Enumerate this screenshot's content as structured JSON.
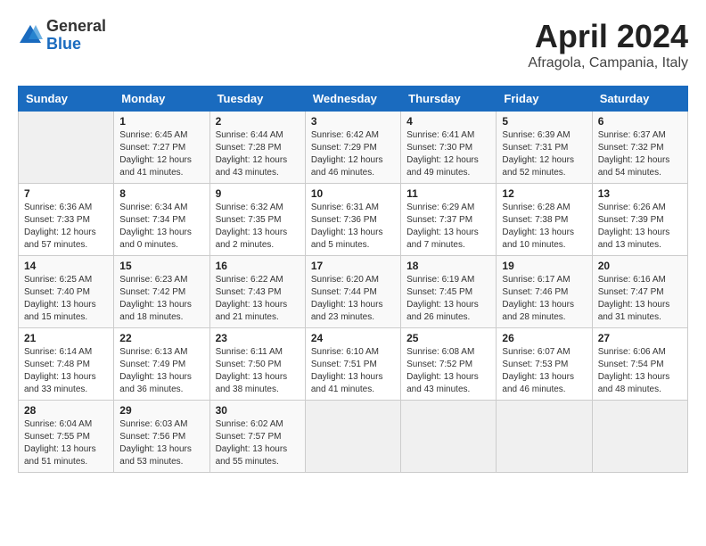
{
  "header": {
    "logo_general": "General",
    "logo_blue": "Blue",
    "month_title": "April 2024",
    "location": "Afragola, Campania, Italy"
  },
  "calendar": {
    "days_of_week": [
      "Sunday",
      "Monday",
      "Tuesday",
      "Wednesday",
      "Thursday",
      "Friday",
      "Saturday"
    ],
    "weeks": [
      [
        {
          "day": "",
          "empty": true
        },
        {
          "day": "1",
          "sunrise": "Sunrise: 6:45 AM",
          "sunset": "Sunset: 7:27 PM",
          "daylight": "Daylight: 12 hours and 41 minutes."
        },
        {
          "day": "2",
          "sunrise": "Sunrise: 6:44 AM",
          "sunset": "Sunset: 7:28 PM",
          "daylight": "Daylight: 12 hours and 43 minutes."
        },
        {
          "day": "3",
          "sunrise": "Sunrise: 6:42 AM",
          "sunset": "Sunset: 7:29 PM",
          "daylight": "Daylight: 12 hours and 46 minutes."
        },
        {
          "day": "4",
          "sunrise": "Sunrise: 6:41 AM",
          "sunset": "Sunset: 7:30 PM",
          "daylight": "Daylight: 12 hours and 49 minutes."
        },
        {
          "day": "5",
          "sunrise": "Sunrise: 6:39 AM",
          "sunset": "Sunset: 7:31 PM",
          "daylight": "Daylight: 12 hours and 52 minutes."
        },
        {
          "day": "6",
          "sunrise": "Sunrise: 6:37 AM",
          "sunset": "Sunset: 7:32 PM",
          "daylight": "Daylight: 12 hours and 54 minutes."
        }
      ],
      [
        {
          "day": "7",
          "sunrise": "Sunrise: 6:36 AM",
          "sunset": "Sunset: 7:33 PM",
          "daylight": "Daylight: 12 hours and 57 minutes."
        },
        {
          "day": "8",
          "sunrise": "Sunrise: 6:34 AM",
          "sunset": "Sunset: 7:34 PM",
          "daylight": "Daylight: 13 hours and 0 minutes."
        },
        {
          "day": "9",
          "sunrise": "Sunrise: 6:32 AM",
          "sunset": "Sunset: 7:35 PM",
          "daylight": "Daylight: 13 hours and 2 minutes."
        },
        {
          "day": "10",
          "sunrise": "Sunrise: 6:31 AM",
          "sunset": "Sunset: 7:36 PM",
          "daylight": "Daylight: 13 hours and 5 minutes."
        },
        {
          "day": "11",
          "sunrise": "Sunrise: 6:29 AM",
          "sunset": "Sunset: 7:37 PM",
          "daylight": "Daylight: 13 hours and 7 minutes."
        },
        {
          "day": "12",
          "sunrise": "Sunrise: 6:28 AM",
          "sunset": "Sunset: 7:38 PM",
          "daylight": "Daylight: 13 hours and 10 minutes."
        },
        {
          "day": "13",
          "sunrise": "Sunrise: 6:26 AM",
          "sunset": "Sunset: 7:39 PM",
          "daylight": "Daylight: 13 hours and 13 minutes."
        }
      ],
      [
        {
          "day": "14",
          "sunrise": "Sunrise: 6:25 AM",
          "sunset": "Sunset: 7:40 PM",
          "daylight": "Daylight: 13 hours and 15 minutes."
        },
        {
          "day": "15",
          "sunrise": "Sunrise: 6:23 AM",
          "sunset": "Sunset: 7:42 PM",
          "daylight": "Daylight: 13 hours and 18 minutes."
        },
        {
          "day": "16",
          "sunrise": "Sunrise: 6:22 AM",
          "sunset": "Sunset: 7:43 PM",
          "daylight": "Daylight: 13 hours and 21 minutes."
        },
        {
          "day": "17",
          "sunrise": "Sunrise: 6:20 AM",
          "sunset": "Sunset: 7:44 PM",
          "daylight": "Daylight: 13 hours and 23 minutes."
        },
        {
          "day": "18",
          "sunrise": "Sunrise: 6:19 AM",
          "sunset": "Sunset: 7:45 PM",
          "daylight": "Daylight: 13 hours and 26 minutes."
        },
        {
          "day": "19",
          "sunrise": "Sunrise: 6:17 AM",
          "sunset": "Sunset: 7:46 PM",
          "daylight": "Daylight: 13 hours and 28 minutes."
        },
        {
          "day": "20",
          "sunrise": "Sunrise: 6:16 AM",
          "sunset": "Sunset: 7:47 PM",
          "daylight": "Daylight: 13 hours and 31 minutes."
        }
      ],
      [
        {
          "day": "21",
          "sunrise": "Sunrise: 6:14 AM",
          "sunset": "Sunset: 7:48 PM",
          "daylight": "Daylight: 13 hours and 33 minutes."
        },
        {
          "day": "22",
          "sunrise": "Sunrise: 6:13 AM",
          "sunset": "Sunset: 7:49 PM",
          "daylight": "Daylight: 13 hours and 36 minutes."
        },
        {
          "day": "23",
          "sunrise": "Sunrise: 6:11 AM",
          "sunset": "Sunset: 7:50 PM",
          "daylight": "Daylight: 13 hours and 38 minutes."
        },
        {
          "day": "24",
          "sunrise": "Sunrise: 6:10 AM",
          "sunset": "Sunset: 7:51 PM",
          "daylight": "Daylight: 13 hours and 41 minutes."
        },
        {
          "day": "25",
          "sunrise": "Sunrise: 6:08 AM",
          "sunset": "Sunset: 7:52 PM",
          "daylight": "Daylight: 13 hours and 43 minutes."
        },
        {
          "day": "26",
          "sunrise": "Sunrise: 6:07 AM",
          "sunset": "Sunset: 7:53 PM",
          "daylight": "Daylight: 13 hours and 46 minutes."
        },
        {
          "day": "27",
          "sunrise": "Sunrise: 6:06 AM",
          "sunset": "Sunset: 7:54 PM",
          "daylight": "Daylight: 13 hours and 48 minutes."
        }
      ],
      [
        {
          "day": "28",
          "sunrise": "Sunrise: 6:04 AM",
          "sunset": "Sunset: 7:55 PM",
          "daylight": "Daylight: 13 hours and 51 minutes."
        },
        {
          "day": "29",
          "sunrise": "Sunrise: 6:03 AM",
          "sunset": "Sunset: 7:56 PM",
          "daylight": "Daylight: 13 hours and 53 minutes."
        },
        {
          "day": "30",
          "sunrise": "Sunrise: 6:02 AM",
          "sunset": "Sunset: 7:57 PM",
          "daylight": "Daylight: 13 hours and 55 minutes."
        },
        {
          "day": "",
          "empty": true
        },
        {
          "day": "",
          "empty": true
        },
        {
          "day": "",
          "empty": true
        },
        {
          "day": "",
          "empty": true
        }
      ]
    ]
  }
}
